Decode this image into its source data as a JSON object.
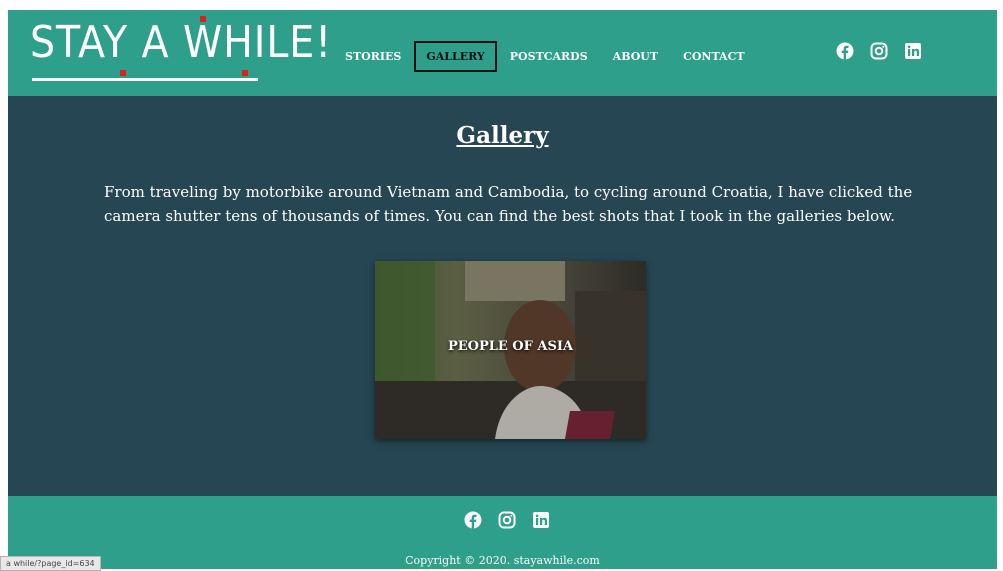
{
  "brand": {
    "logo_text": "STAY A WHILE!",
    "colors": {
      "teal": "#2e9f8a",
      "navy": "#264653",
      "accent_red": "#e0201a"
    }
  },
  "nav": {
    "items": [
      "STORIES",
      "GALLERY",
      "POSTCARDS",
      "ABOUT",
      "CONTACT"
    ],
    "active": "GALLERY"
  },
  "social": [
    "facebook-icon",
    "instagram-icon",
    "linkedin-icon"
  ],
  "main": {
    "title": "Gallery",
    "intro": "From traveling by motorbike around Vietnam and Cambodia, to cycling around Croatia, I have clicked the camera shutter tens of thousands of times. You can find the best shots that I took in the galleries below.",
    "gallery": [
      {
        "label": "PEOPLE OF ASIA"
      }
    ]
  },
  "footer": {
    "copyright": "Copyright © 2020. stayawhile.com"
  },
  "status_bar": {
    "url": "a while/?page_id=634"
  }
}
